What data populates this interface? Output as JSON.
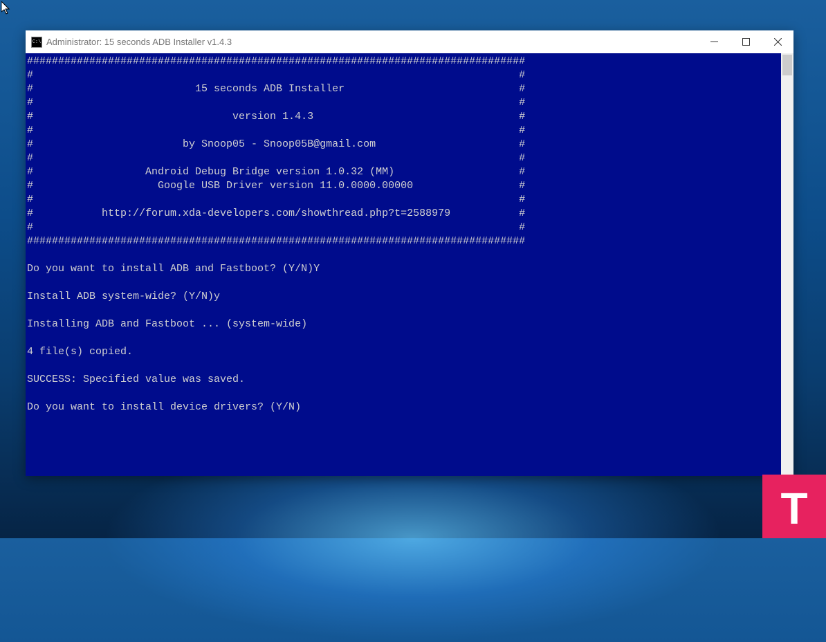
{
  "window": {
    "title": "Administrator:  15 seconds ADB Installer v1.4.3",
    "icon_label": "C:\\"
  },
  "console": {
    "lines": [
      "################################################################################",
      "#                                                                              #",
      "#                          15 seconds ADB Installer                            #",
      "#                                                                              #",
      "#                                version 1.4.3                                 #",
      "#                                                                              #",
      "#                        by Snoop05 - Snoop05B@gmail.com                       #",
      "#                                                                              #",
      "#                  Android Debug Bridge version 1.0.32 (MM)                    #",
      "#                    Google USB Driver version 11.0.0000.00000                 #",
      "#                                                                              #",
      "#           http://forum.xda-developers.com/showthread.php?t=2588979           #",
      "#                                                                              #",
      "################################################################################",
      "",
      "Do you want to install ADB and Fastboot? (Y/N)Y",
      "",
      "Install ADB system-wide? (Y/N)y",
      "",
      "Installing ADB and Fastboot ... (system-wide)",
      "",
      "4 file(s) copied.",
      "",
      "SUCCESS: Specified value was saved.",
      "",
      "Do you want to install device drivers? (Y/N)"
    ]
  },
  "watermark": {
    "letter": "T"
  }
}
